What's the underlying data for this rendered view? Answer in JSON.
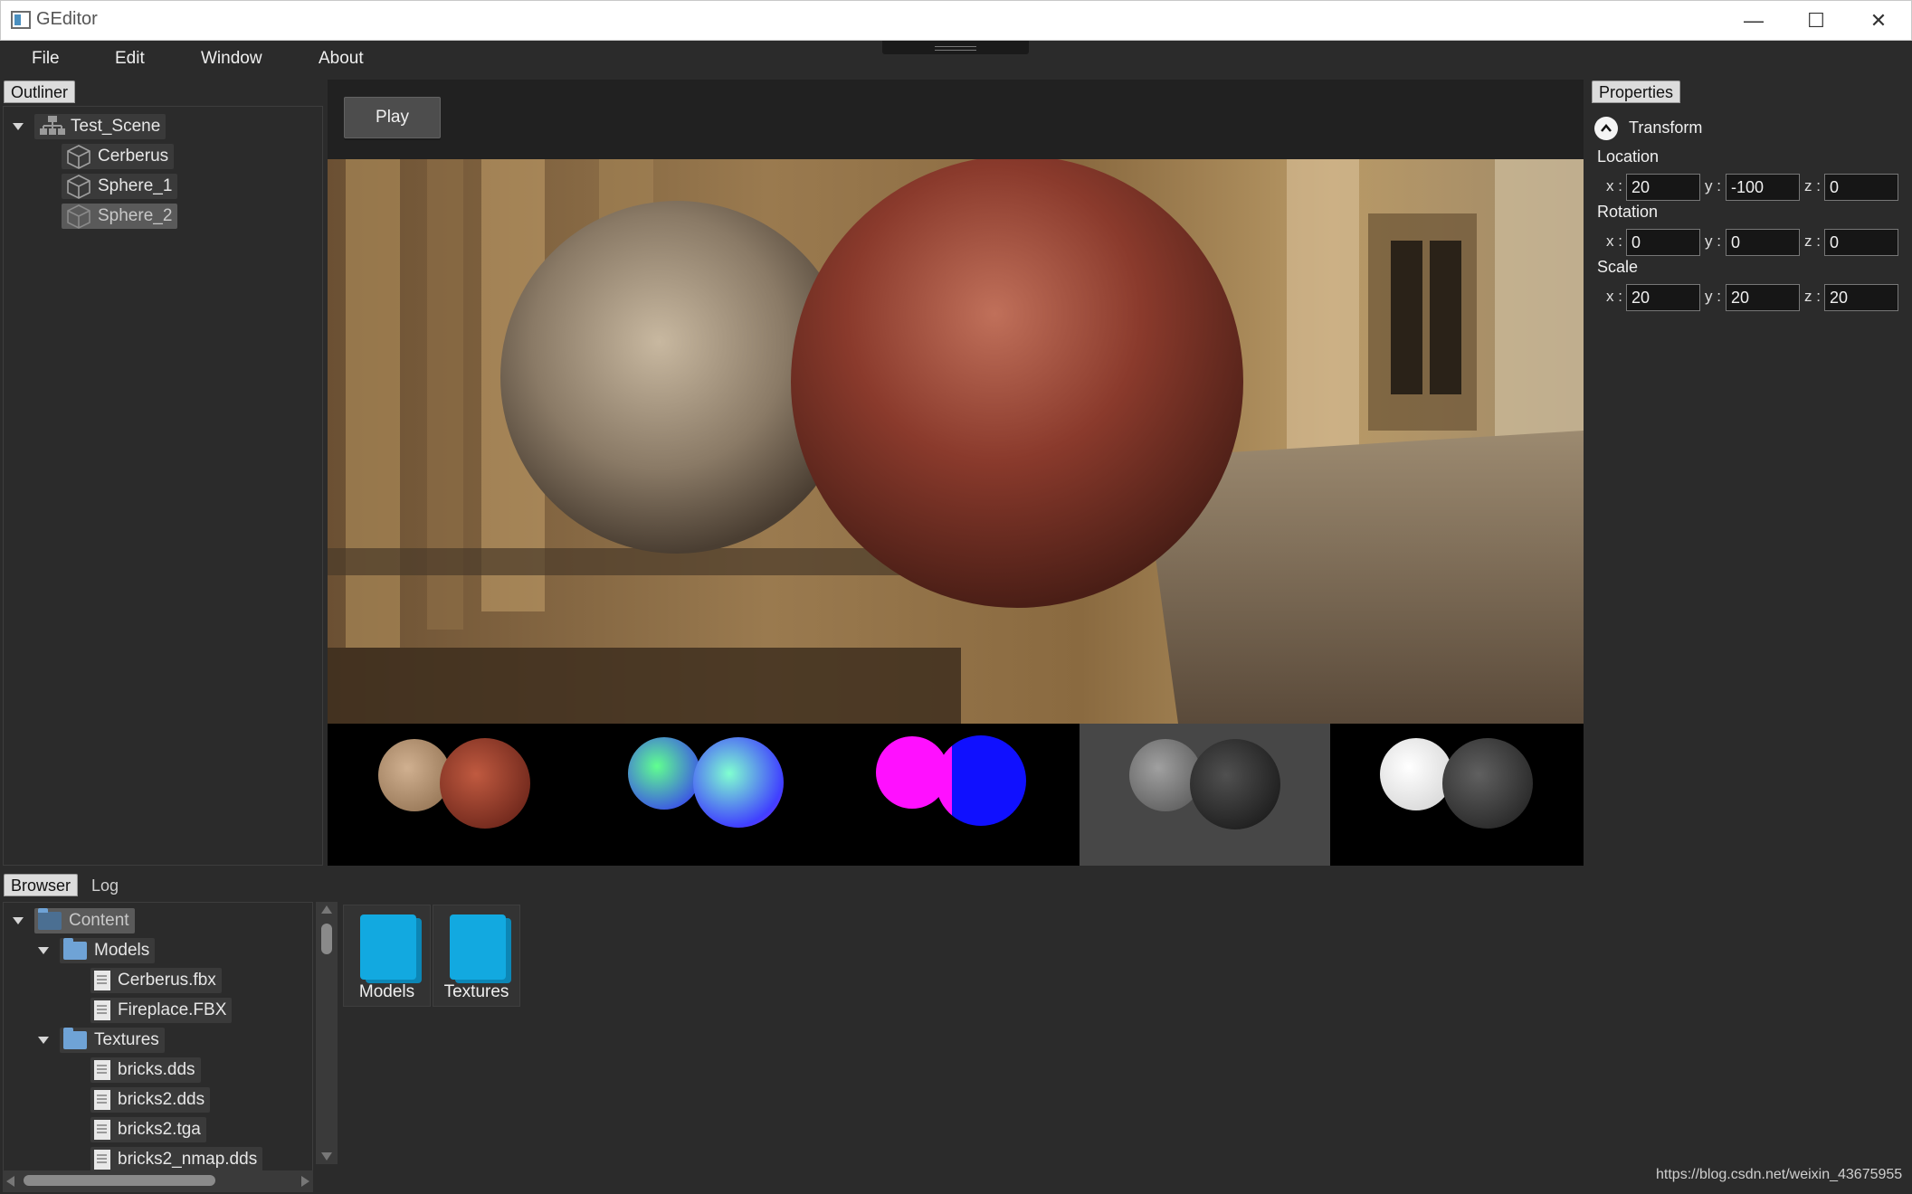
{
  "window": {
    "title": "GEditor",
    "controls": {
      "minimize": "—",
      "maximize": "☐",
      "close": "✕"
    }
  },
  "menu": [
    "File",
    "Edit",
    "Window",
    "About"
  ],
  "outliner": {
    "tab": "Outliner",
    "root": "Test_Scene",
    "children": [
      "Cerberus",
      "Sphere_1",
      "Sphere_2"
    ],
    "selected": "Sphere_2"
  },
  "viewport": {
    "play_label": "Play"
  },
  "properties": {
    "tab": "Properties",
    "section": "Transform",
    "location": {
      "label": "Location",
      "x": "20",
      "y": "-100",
      "z": "0"
    },
    "rotation": {
      "label": "Rotation",
      "x": "0",
      "y": "0",
      "z": "0"
    },
    "scale": {
      "label": "Scale",
      "x": "20",
      "y": "20",
      "z": "20"
    },
    "axis_x": "x :",
    "axis_y": "y :",
    "axis_z": "z :"
  },
  "browser": {
    "tabs": [
      "Browser",
      "Log"
    ],
    "tree": {
      "root": "Content",
      "models_folder": "Models",
      "models_files": [
        "Cerberus.fbx",
        "Fireplace.FBX"
      ],
      "textures_folder": "Textures",
      "textures_files": [
        "bricks.dds",
        "bricks2.dds",
        "bricks2.tga",
        "bricks2_nmap.dds"
      ]
    },
    "folders": [
      "Models",
      "Textures"
    ]
  },
  "watermark": "https://blog.csdn.net/weixin_43675955"
}
